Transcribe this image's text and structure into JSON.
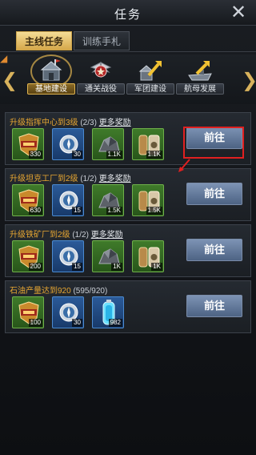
{
  "window": {
    "title": "任务"
  },
  "tabs": [
    {
      "label": "主线任务",
      "active": true
    },
    {
      "label": "训练手札",
      "active": false
    }
  ],
  "categories": [
    {
      "label": "基地建设",
      "active": true,
      "icon": "base-building-icon"
    },
    {
      "label": "通关战役",
      "active": false,
      "icon": "campaign-wings-icon"
    },
    {
      "label": "军团建设",
      "active": false,
      "icon": "legion-arrow-icon"
    },
    {
      "label": "航母发展",
      "active": false,
      "icon": "carrier-arrow-icon"
    }
  ],
  "tasks": [
    {
      "title": "升级指挥中心到3级",
      "progress": "(2/3)",
      "more": "更多奖励",
      "button": "前往",
      "rewards": [
        {
          "icon": "exp-badge-icon",
          "qty": "330"
        },
        {
          "icon": "compass-medal-icon",
          "qty": "30"
        },
        {
          "icon": "ore-rock-icon",
          "qty": "1.1K"
        },
        {
          "icon": "ammo-shell-icon",
          "qty": "1.1K"
        }
      ]
    },
    {
      "title": "升级坦克工厂到2级",
      "progress": "(1/2)",
      "more": "更多奖励",
      "button": "前往",
      "rewards": [
        {
          "icon": "exp-badge-icon",
          "qty": "630"
        },
        {
          "icon": "compass-medal-icon",
          "qty": "15"
        },
        {
          "icon": "ore-rock-icon",
          "qty": "1.5K"
        },
        {
          "icon": "ammo-shell-icon",
          "qty": "1.5K"
        }
      ]
    },
    {
      "title": "升级铁矿厂到2级",
      "progress": "(1/2)",
      "more": "更多奖励",
      "button": "前往",
      "rewards": [
        {
          "icon": "exp-badge-icon",
          "qty": "200"
        },
        {
          "icon": "compass-medal-icon",
          "qty": "15"
        },
        {
          "icon": "ore-rock-icon",
          "qty": "1K"
        },
        {
          "icon": "ammo-shell-icon",
          "qty": "1K"
        }
      ]
    },
    {
      "title": "石油产量达到920",
      "progress": "(595/920)",
      "more": "",
      "button": "前往",
      "rewards": [
        {
          "icon": "exp-badge-icon",
          "qty": "100"
        },
        {
          "icon": "compass-medal-icon",
          "qty": "30"
        },
        {
          "icon": "fuel-canister-icon",
          "qty": "982"
        }
      ]
    }
  ],
  "colors": {
    "accent_gold": "#e6a632",
    "button_blue": "#5d7396",
    "highlight_red": "#e02020"
  }
}
